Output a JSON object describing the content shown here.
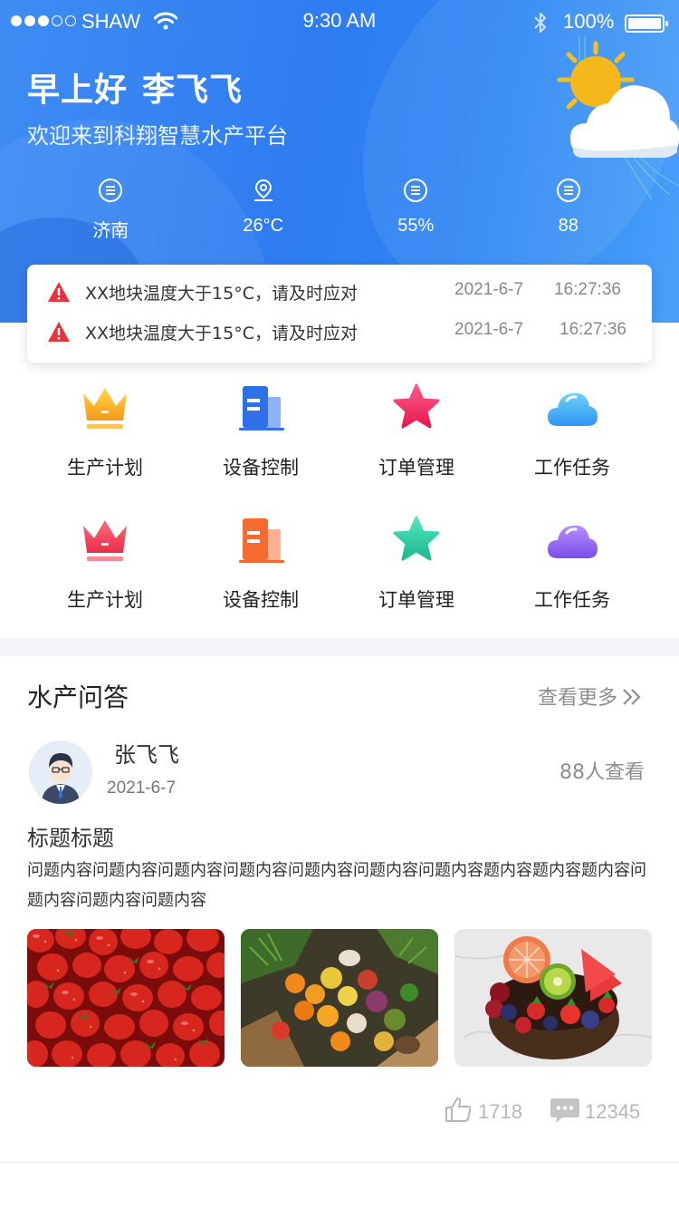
{
  "status_bar": {
    "carrier": "SHAW",
    "time": "9:30 AM",
    "battery": "100%"
  },
  "header": {
    "greeting": "早上好",
    "user_name": "李飞飞",
    "subtitle": "欢迎来到科翔智慧水产平台",
    "stats": [
      {
        "icon": "list-circle-icon",
        "value": "济南"
      },
      {
        "icon": "location-pin-icon",
        "value": "26°C"
      },
      {
        "icon": "list-circle-icon",
        "value": "55%"
      },
      {
        "icon": "list-circle-icon",
        "value": "88"
      }
    ]
  },
  "alerts": [
    {
      "icon": "warning-icon",
      "message": "XX地块温度大于15°C，请及时应对",
      "date": "2021-6-7",
      "time": "16:27:36"
    },
    {
      "icon": "warning-icon",
      "message": "XX地块温度大于15°C，请及时应对",
      "date": "2021-6-7",
      "time": "16:27:36"
    }
  ],
  "menu": [
    {
      "label": "生产计划",
      "icon": "crown-icon",
      "color": "#f5a623"
    },
    {
      "label": "设备控制",
      "icon": "building-icon",
      "color": "#2f6fe8"
    },
    {
      "label": "订单管理",
      "icon": "star-icon",
      "color": "#f0326e"
    },
    {
      "label": "工作任务",
      "icon": "cloud-icon",
      "color": "#3aa8f5"
    },
    {
      "label": "生产计划",
      "icon": "crown-icon",
      "color": "#f03c5a"
    },
    {
      "label": "设备控制",
      "icon": "building-icon",
      "color": "#f56a2f"
    },
    {
      "label": "订单管理",
      "icon": "star-icon",
      "color": "#2ed1a4"
    },
    {
      "label": "工作任务",
      "icon": "cloud-icon",
      "color": "#8a5cf0"
    }
  ],
  "qa": {
    "section_title": "水产问答",
    "more_label": "查看更多",
    "post": {
      "author": "张飞飞",
      "date": "2021-6-7",
      "views": "88人查看",
      "title": "标题标题",
      "body": "问题内容问题内容问题内容问题内容问题内容问题内容问题内容题内容题内容题内容问题内容问题内容问题内容",
      "photos": [
        "strawberries-photo",
        "vegetables-photo",
        "fruit-bowl-photo"
      ],
      "likes": "1718",
      "comments": "12345"
    }
  }
}
